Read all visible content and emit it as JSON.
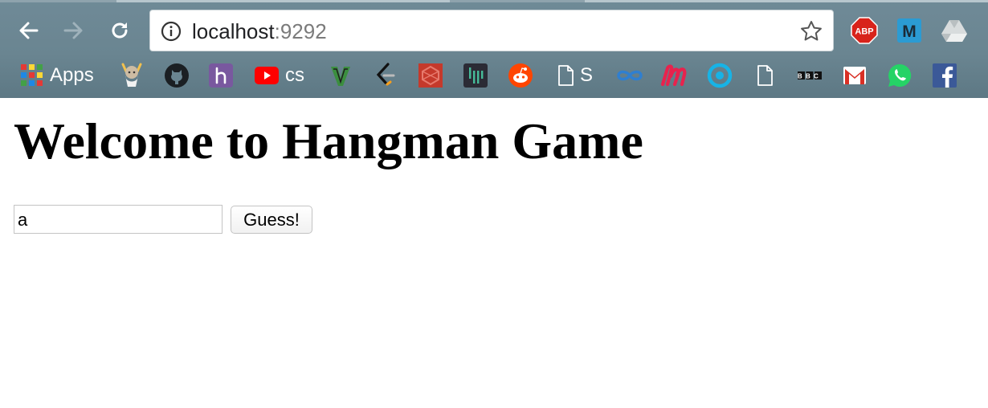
{
  "browser": {
    "address": {
      "host": "localhost",
      "port": ":9292"
    },
    "extensions": {
      "adblock_label": "ABP",
      "m_label": "M"
    },
    "bookmarks": {
      "apps_label": "Apps",
      "youtube_label": "cs",
      "doc_s_label": "S",
      "bbc_label": "BBC"
    }
  },
  "page": {
    "title": "Welcome to Hangman Game",
    "guess_input": {
      "value": "a"
    },
    "guess_button_label": "Guess!"
  },
  "colors": {
    "chrome": "#6a8591",
    "adblock": "#d8231b",
    "youtube": "#ff0000",
    "reddit": "#ff4500",
    "whatsapp": "#25d366",
    "facebook": "#3b5998"
  }
}
